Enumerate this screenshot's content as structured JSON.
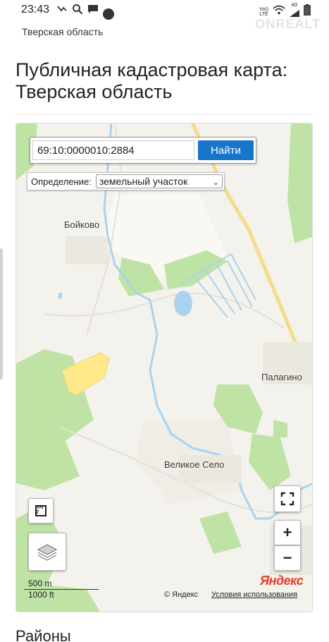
{
  "status_bar": {
    "time": "23:43",
    "network_label_top": "Vo))",
    "network_label_bottom": "LTE",
    "signal_label": "4G",
    "left_icons": [
      "missed-call-icon",
      "search-icon",
      "message-icon",
      "dot-icon"
    ],
    "right_icons": [
      "wifi-icon",
      "signal-icon",
      "battery-icon"
    ]
  },
  "watermark": "ONREALT",
  "breadcrumb": "Тверская область",
  "page_title": "Публичная кадастровая карта: Тверская область",
  "map": {
    "search_value": "69:10:0000010:2884",
    "search_button": "Найти",
    "definition_label": "Определение:",
    "definition_value": "земельный участок",
    "places": {
      "boikovo": "Бойково",
      "palagino": "Палагино",
      "velikoe_selo": "Великое Село"
    },
    "scale_metric": "500 m",
    "scale_imperial": "1000 ft",
    "provider_logo": "Яндекс",
    "copyright": "© Яндекс",
    "terms_link": "Условия использования",
    "zoom_in": "+",
    "zoom_out": "−",
    "colors": {
      "forest": "#bfe3a4",
      "water": "#a9d3ee",
      "road": "#f5e3a0",
      "parcel": "#ffe98a",
      "button": "#1776c9"
    }
  },
  "section_heading": "Районы"
}
